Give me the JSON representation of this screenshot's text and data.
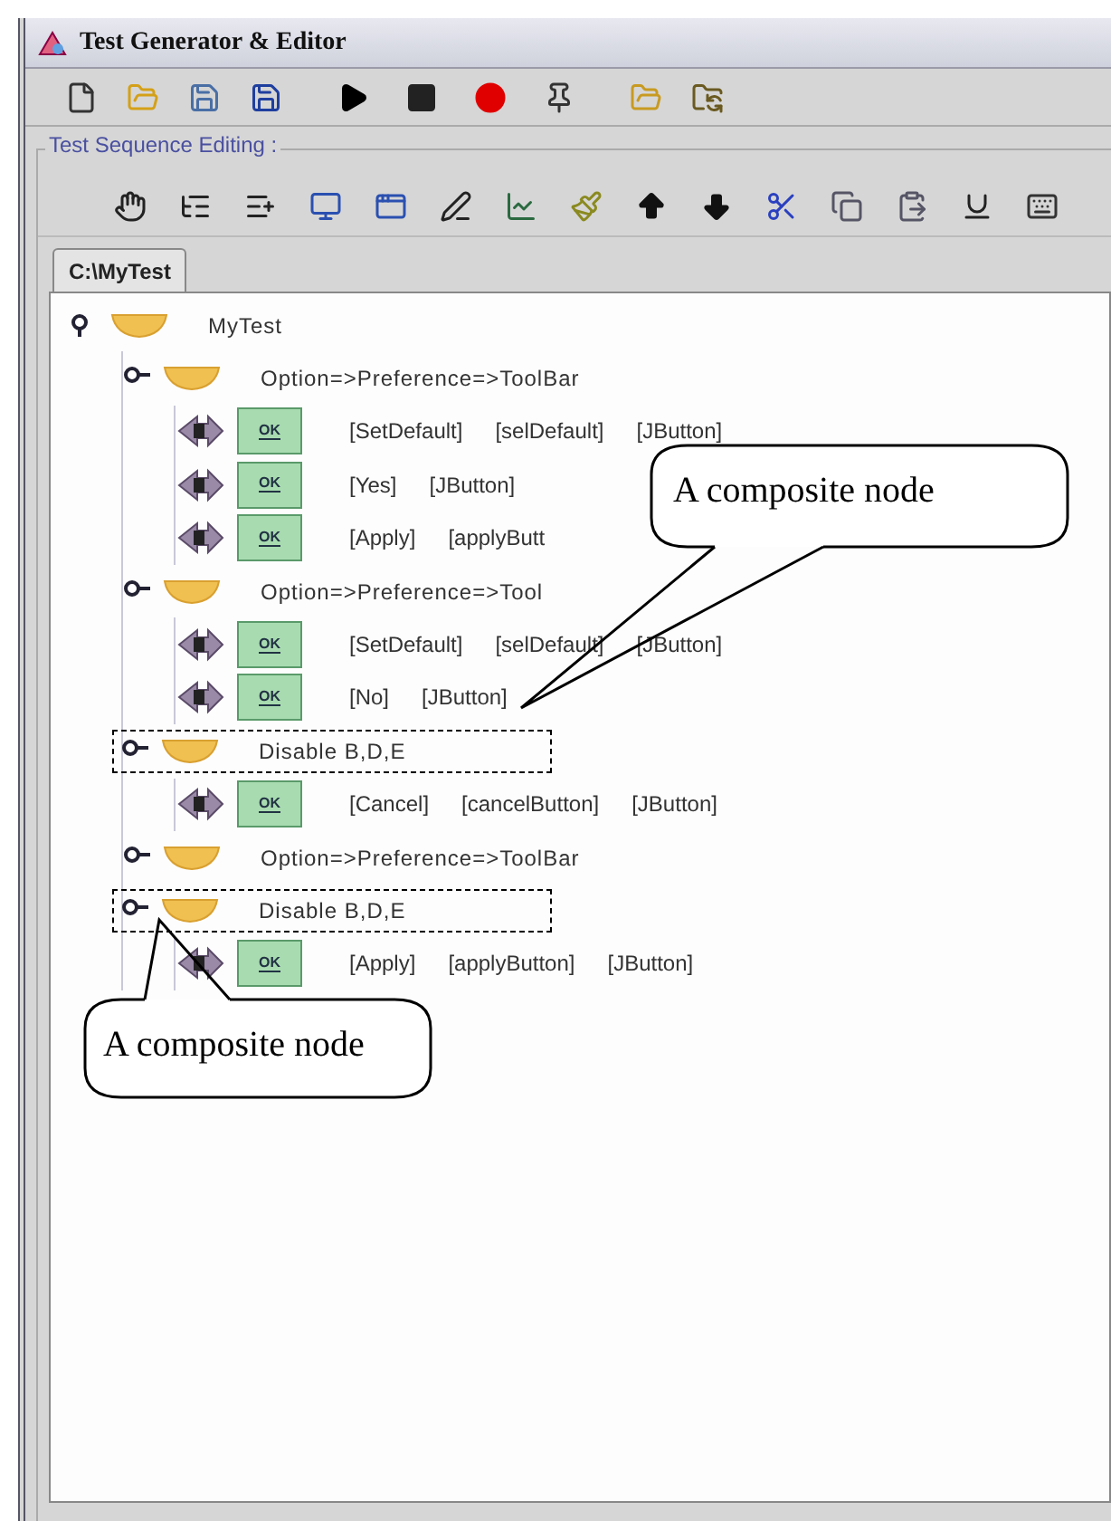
{
  "window": {
    "title": "Test Generator & Editor"
  },
  "editing_panel": {
    "label": "Test Sequence Editing :"
  },
  "tabs": [
    {
      "label": "C:\\MyTest",
      "selected": true
    }
  ],
  "tree": {
    "kind": "composite",
    "label": "MyTest",
    "expanded": true,
    "highlighted": false,
    "children": [
      {
        "kind": "composite",
        "label": "Option=>Preference=>ToolBar",
        "expanded": false,
        "highlighted": false,
        "children": [
          {
            "kind": "leaf",
            "icon_text": "OK",
            "fields": [
              "[SetDefault]",
              "[selDefault]",
              "[JButton]"
            ]
          },
          {
            "kind": "leaf",
            "icon_text": "OK",
            "fields": [
              "[Yes]",
              "[JButton]"
            ]
          },
          {
            "kind": "leaf",
            "icon_text": "OK",
            "fields": [
              "[Apply]",
              "[applyButt"
            ]
          }
        ]
      },
      {
        "kind": "composite",
        "label": "Option=>Preference=>Tool",
        "expanded": false,
        "highlighted": false,
        "children": [
          {
            "kind": "leaf",
            "icon_text": "OK",
            "fields": [
              "[SetDefault]",
              "[selDefault]",
              "[JButton]"
            ]
          },
          {
            "kind": "leaf",
            "icon_text": "OK",
            "fields": [
              "[No]",
              "[JButton]"
            ]
          }
        ]
      },
      {
        "kind": "composite",
        "label": "Disable B,D,E",
        "expanded": false,
        "highlighted": true,
        "children": [
          {
            "kind": "leaf",
            "icon_text": "OK",
            "fields": [
              "[Cancel]",
              "[cancelButton]",
              "[JButton]"
            ]
          }
        ]
      },
      {
        "kind": "composite",
        "label": "Option=>Preference=>ToolBar",
        "expanded": false,
        "highlighted": false
      },
      {
        "kind": "composite",
        "label": "Disable B,D,E",
        "expanded": false,
        "highlighted": true,
        "children": [
          {
            "kind": "leaf",
            "icon_text": "OK",
            "fields": [
              "[Apply]",
              "[applyButton]",
              "[JButton]"
            ]
          }
        ]
      }
    ]
  },
  "callouts": [
    {
      "text": "A composite node"
    },
    {
      "text": "A composite node"
    }
  ]
}
